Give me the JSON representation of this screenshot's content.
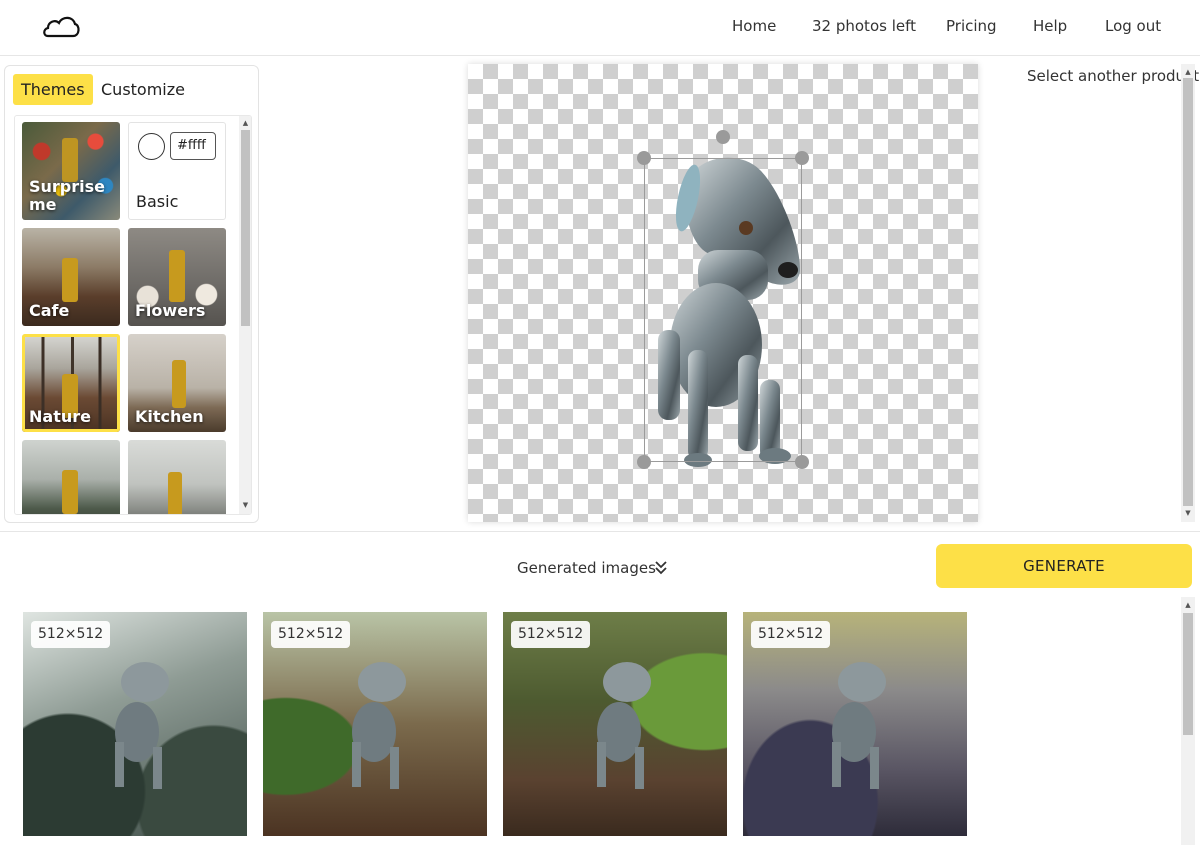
{
  "nav": {
    "home": "Home",
    "photos_left": "32 photos left",
    "pricing": "Pricing",
    "help": "Help",
    "logout": "Log out"
  },
  "tabs": {
    "themes": "Themes",
    "customize": "Customize",
    "active": "Themes"
  },
  "themes": [
    {
      "label": "Surprise me",
      "selected": false
    },
    {
      "label": "Basic",
      "selected": false,
      "color_value": "#ffff"
    },
    {
      "label": "Cafe",
      "selected": false
    },
    {
      "label": "Flowers",
      "selected": false
    },
    {
      "label": "Nature",
      "selected": true
    },
    {
      "label": "Kitchen",
      "selected": false
    }
  ],
  "select_another": "Select another product",
  "generated_label": "Generated images",
  "generate_button": "GENERATE",
  "results": [
    {
      "size": "512×512"
    },
    {
      "size": "512×512"
    },
    {
      "size": "512×512"
    },
    {
      "size": "512×512"
    }
  ],
  "colors": {
    "accent": "#fde047"
  }
}
